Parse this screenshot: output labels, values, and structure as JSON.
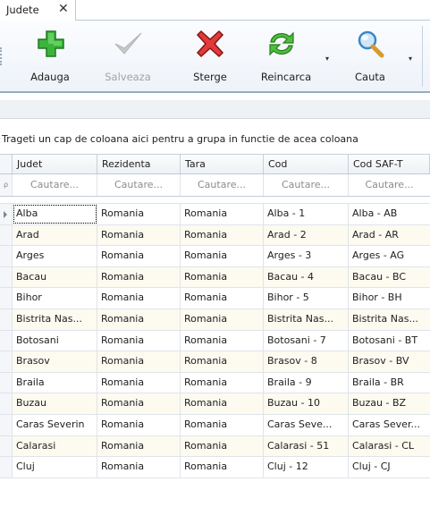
{
  "tab": {
    "title": "Judete",
    "close_glyph": "✕"
  },
  "toolbar": {
    "add_label": "Adauga",
    "save_label": "Salveaza",
    "delete_label": "Sterge",
    "reload_label": "Reincarca",
    "search_label": "Cauta",
    "dropdown_glyph": "▾"
  },
  "group_panel": {
    "text": "Trageti un cap de coloana aici pentru a grupa in functie de acea coloana"
  },
  "grid": {
    "columns": [
      "Judet",
      "Rezidenta",
      "Tara",
      "Cod",
      "Cod SAF-T"
    ],
    "filter_placeholder": "Cautare...",
    "filter_glyph": "ρ",
    "rows": [
      [
        "Alba",
        "Romania",
        "Romania",
        "Alba - 1",
        "Alba - AB"
      ],
      [
        "Arad",
        "Romania",
        "Romania",
        "Arad - 2",
        "Arad - AR"
      ],
      [
        "Arges",
        "Romania",
        "Romania",
        "Arges - 3",
        "Arges - AG"
      ],
      [
        "Bacau",
        "Romania",
        "Romania",
        "Bacau - 4",
        "Bacau - BC"
      ],
      [
        "Bihor",
        "Romania",
        "Romania",
        "Bihor - 5",
        "Bihor - BH"
      ],
      [
        "Bistrita Nas...",
        "Romania",
        "Romania",
        "Bistrita Nas...",
        "Bistrita Nas..."
      ],
      [
        "Botosani",
        "Romania",
        "Romania",
        "Botosani - 7",
        "Botosani - BT"
      ],
      [
        "Brasov",
        "Romania",
        "Romania",
        "Brasov - 8",
        "Brasov - BV"
      ],
      [
        "Braila",
        "Romania",
        "Romania",
        "Braila - 9",
        "Braila - BR"
      ],
      [
        "Buzau",
        "Romania",
        "Romania",
        "Buzau - 10",
        "Buzau - BZ"
      ],
      [
        "Caras Severin",
        "Romania",
        "Romania",
        "Caras Seve...",
        "Caras Sever..."
      ],
      [
        "Calarasi",
        "Romania",
        "Romania",
        "Calarasi - 51",
        "Calarasi - CL"
      ],
      [
        "Cluj",
        "Romania",
        "Romania",
        "Cluj - 12",
        "Cluj - CJ"
      ]
    ]
  },
  "colors": {
    "alt_row": "#fdfaf0",
    "header_border": "#9aabc0",
    "disabled_text": "#a3a3a3"
  }
}
